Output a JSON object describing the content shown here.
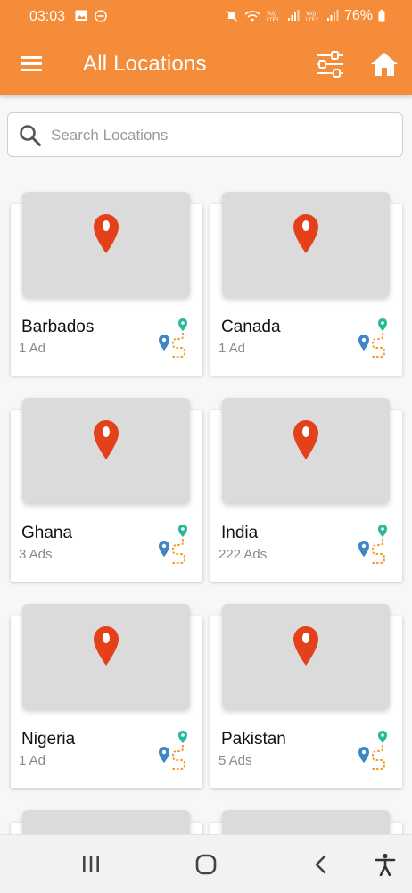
{
  "status_bar": {
    "time": "03:03",
    "battery": "76%",
    "icons": [
      "gallery-icon",
      "do-not-disturb-icon",
      "mute-icon",
      "wifi-icon",
      "volte-lte1-icon",
      "signal-icon",
      "volte-lte2-icon",
      "signal-icon",
      "battery-icon"
    ]
  },
  "app_bar": {
    "title": "All Locations",
    "menu_icon": "hamburger-menu-icon",
    "filter_icon": "filter-sliders-icon",
    "home_icon": "home-icon",
    "background": "#f58c3a"
  },
  "search": {
    "placeholder": "Search Locations",
    "value": ""
  },
  "locations": [
    {
      "name": "Barbados",
      "count": "1 Ad"
    },
    {
      "name": "Canada",
      "count": "1 Ad"
    },
    {
      "name": "Ghana",
      "count": "3 Ads"
    },
    {
      "name": "India",
      "count": "222 Ads"
    },
    {
      "name": "Nigeria",
      "count": "1 Ad"
    },
    {
      "name": "Pakistan",
      "count": "5 Ads"
    }
  ],
  "colors": {
    "accent": "#f58c3a",
    "pin": "#e4411b",
    "route_green": "#26b99a",
    "route_blue": "#3f86c6",
    "route_orange": "#f39c2b"
  },
  "nav_bar": {
    "icons": [
      "recent-apps-icon",
      "home-circle-icon",
      "back-icon",
      "accessibility-icon"
    ]
  }
}
